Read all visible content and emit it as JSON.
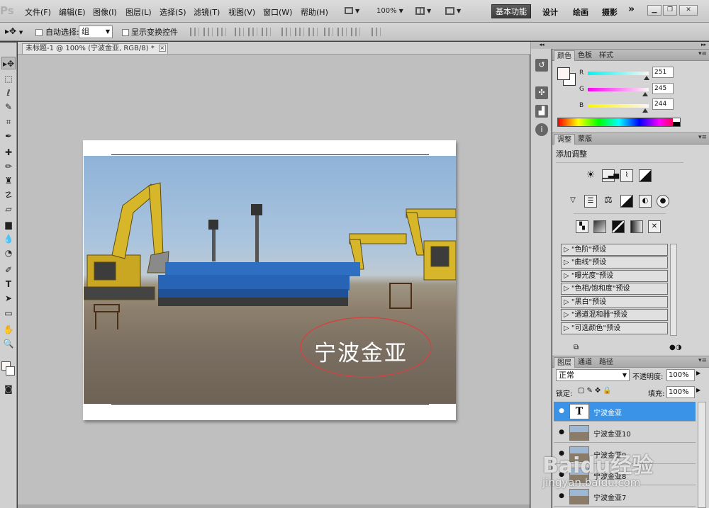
{
  "menubar": {
    "logo": "Ps",
    "items": [
      "文件(F)",
      "编辑(E)",
      "图像(I)",
      "图层(L)",
      "选择(S)",
      "滤镜(T)",
      "视图(V)",
      "窗口(W)",
      "帮助(H)"
    ],
    "zoom": "100%",
    "workspace_active": "基本功能",
    "workspace_items": [
      "设计",
      "绘画",
      "摄影"
    ],
    "more": "»"
  },
  "optbar": {
    "auto_select_label": "自动选择:",
    "auto_select_value": "组",
    "show_transform_label": "显示变换控件"
  },
  "document": {
    "tab_title": "未标题-1 @ 100% (宁波金亚, RGB/8) *",
    "close": "×",
    "photo_text": "宁波金亚"
  },
  "color_panel": {
    "tabs": [
      "颜色",
      "色板",
      "样式"
    ],
    "r_label": "R",
    "r_value": "251",
    "g_label": "G",
    "g_value": "245",
    "b_label": "B",
    "b_value": "244"
  },
  "adjust_panel": {
    "tabs": [
      "调整",
      "蒙版"
    ],
    "heading": "添加调整",
    "presets": [
      "\"色阶\"预设",
      "\"曲线\"预设",
      "\"曝光度\"预设",
      "\"色相/饱和度\"预设",
      "\"黑白\"预设",
      "\"通道混和器\"预设",
      "\"可选颜色\"预设"
    ]
  },
  "layers_panel": {
    "tabs": [
      "图层",
      "通道",
      "路径"
    ],
    "blend_mode": "正常",
    "opacity_label": "不透明度:",
    "opacity_value": "100%",
    "lock_label": "锁定:",
    "fill_label": "填充:",
    "fill_value": "100%",
    "layers": [
      {
        "name": "宁波金亚",
        "selected": true,
        "thumb": "T"
      },
      {
        "name": "宁波金亚10",
        "selected": false
      },
      {
        "name": "宁波金亚9",
        "selected": false
      },
      {
        "name": "宁波金亚8",
        "selected": false
      },
      {
        "name": "宁波金亚7",
        "selected": false
      }
    ]
  },
  "watermark": {
    "brand": "Baidu经验",
    "url": "jingyan.baidu.com"
  }
}
